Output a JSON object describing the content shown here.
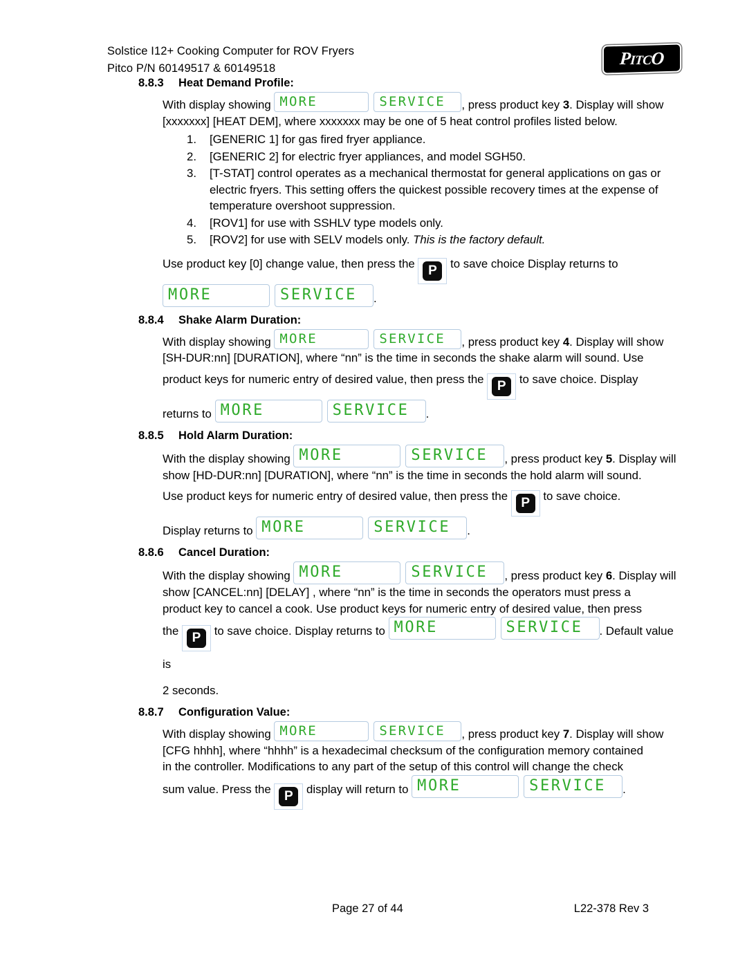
{
  "header": {
    "line1": "Solstice I12+ Cooking Computer for ROV Fryers",
    "line2": "Pitco P/N 60149517 & 60149518",
    "logo_main": "ITC",
    "logo_first": "P",
    "logo_last": "O",
    "logo_alt": "pitco-logo"
  },
  "display": {
    "more": "MORE",
    "service": "SERVICE",
    "lcd_green": "#2faa2b",
    "lcd_border": "#b4cae0",
    "pkey_label": "P"
  },
  "sections": {
    "heat_demand": {
      "number": "8.8.3",
      "title": "Heat Demand Profile:",
      "p1_a": "With display showing",
      "p1_b": ", press product key",
      "p1_key": "3",
      "p1_c": ".  Display will show",
      "p2": "[xxxxxxx] [HEAT DEM], where xxxxxxx may be one of 5 heat control profiles listed below.",
      "profiles": [
        {
          "num": "1.",
          "text": "[GENERIC 1] for gas fired fryer appliance."
        },
        {
          "num": "2.",
          "text": "[GENERIC 2] for electric fryer appliances, and model SGH50."
        },
        {
          "num": "3.",
          "text": "[T-STAT] control operates as a mechanical thermostat for general applications on gas or electric fryers.  This setting offers the quickest possible recovery times at the expense of temperature overshoot suppression."
        },
        {
          "num": "4.",
          "text": "[ROV1] for use with SSHLV type models only."
        },
        {
          "num": "5.",
          "text": "[ROV2] for use with SELV models only. ",
          "italic": "This is the factory default."
        }
      ],
      "p3_a": "Use product key [0] change value, then press the",
      "p3_b": "to save choice Display returns to",
      "p4_end": "."
    },
    "shake_alarm": {
      "number": "8.8.4",
      "title": "Shake Alarm Duration:",
      "p1_a": "With display showing",
      "p1_b": ", press product key",
      "p1_key": "4",
      "p1_c": ".  Display will show",
      "p2": "[SH-DUR:nn] [DURATION], where “nn” is the time in seconds the shake alarm will sound. Use",
      "p3_a": "product keys for numeric entry of desired value, then press the",
      "p3_b": "to save choice. Display",
      "p4_a": "returns to",
      "p4_end": "."
    },
    "hold_alarm": {
      "number": "8.8.5",
      "title": "Hold Alarm Duration:",
      "p1_a": "With the display showing",
      "p1_b": ", press product key",
      "p1_key": "5",
      "p1_c": ".  Display will",
      "p2": "show [HD-DUR:nn] [DURATION], where “nn” is the time in seconds the hold alarm will sound.",
      "p3_a": "Use product keys for numeric entry of desired value, then press the",
      "p3_b": "to save choice.",
      "p4_a": "Display returns to",
      "p4_end": "."
    },
    "cancel_duration": {
      "number": "8.8.6",
      "title": "Cancel Duration:",
      "p1_a": "With the display showing",
      "p1_b": ", press product key",
      "p1_key": "6",
      "p1_c": ".  Display will",
      "p2": "show [CANCEL:nn] [DELAY] , where “nn” is the time in seconds the operators must press a",
      "p3": "product key to cancel a cook. Use product keys for numeric entry of desired value, then press",
      "p4_a": "the",
      "p4_b": "to save choice. Display returns to",
      "p4_c": ".  Default value is",
      "p5": "2 seconds."
    },
    "configuration_value": {
      "number": "8.8.7",
      "title": "Configuration Value:",
      "p1_a": "With display showing",
      "p1_b": ", press product key",
      "p1_key": "7",
      "p1_c": ".  Display will show",
      "p2": "[CFG  hhhh], where “hhhh” is a hexadecimal checksum of the configuration memory contained",
      "p3": "in the controller.  Modifications to any part of the setup of this control will change the check",
      "p4_a": "sum value. Press the",
      "p4_b": "display will return to",
      "p4_end": "."
    }
  },
  "footer": {
    "page": "Page 27 of 44",
    "revision": "L22-378 Rev 3"
  }
}
